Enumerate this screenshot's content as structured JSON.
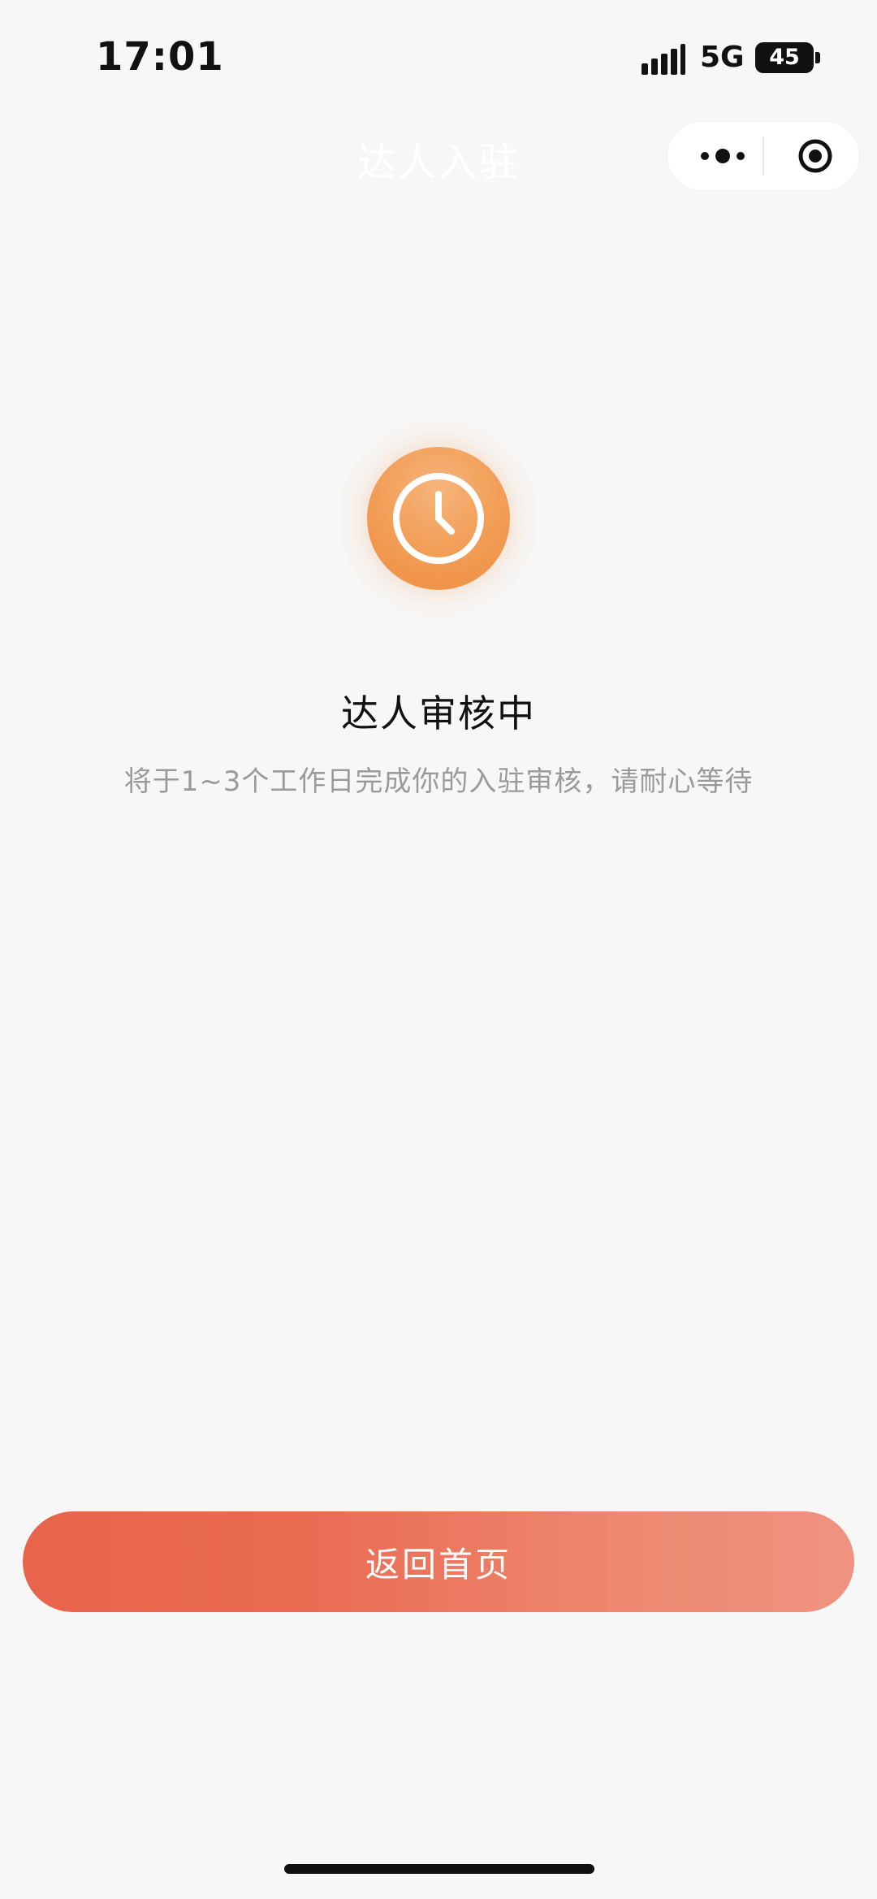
{
  "status_bar": {
    "time": "17:01",
    "network": "5G",
    "battery": "45"
  },
  "nav": {
    "title": "达人入驻"
  },
  "status": {
    "headline": "达人审核中",
    "message": "将于1~3个工作日完成你的入驻审核，请耐心等待",
    "icon": "clock-icon"
  },
  "actions": {
    "back_home_label": "返回首页"
  },
  "colors": {
    "accent_orange": "#F09354",
    "cta_gradient_start": "#E8644B",
    "cta_gradient_end": "#EF9380",
    "text_primary": "#111111",
    "text_secondary": "#9A9A9A",
    "background": "#F7F7F7"
  }
}
